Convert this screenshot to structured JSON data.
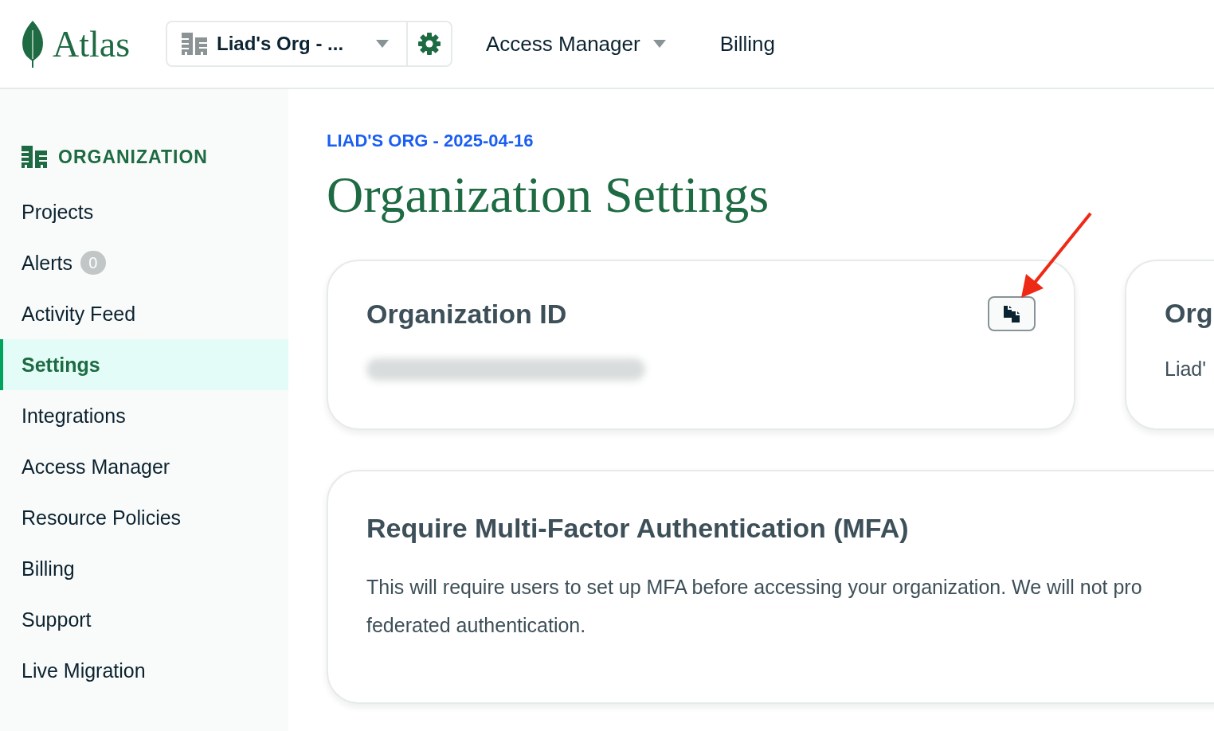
{
  "header": {
    "logo": "Atlas",
    "org_selector": {
      "value": "Liad's Org - ..."
    },
    "nav": [
      {
        "label": "Access Manager",
        "kind": "dropdown"
      },
      {
        "label": "Billing",
        "kind": "link"
      }
    ]
  },
  "sidebar": {
    "heading": "ORGANIZATION",
    "items": [
      {
        "label": "Projects",
        "selected": false
      },
      {
        "label": "Alerts",
        "selected": false,
        "badge": "0"
      },
      {
        "label": "Activity Feed",
        "selected": false
      },
      {
        "label": "Settings",
        "selected": true
      },
      {
        "label": "Integrations",
        "selected": false
      },
      {
        "label": "Access Manager",
        "selected": false
      },
      {
        "label": "Resource Policies",
        "selected": false
      },
      {
        "label": "Billing",
        "selected": false
      },
      {
        "label": "Support",
        "selected": false
      },
      {
        "label": "Live Migration",
        "selected": false
      }
    ]
  },
  "main": {
    "breadcrumb": "LIAD'S ORG - 2025-04-16",
    "title": "Organization Settings",
    "cards": [
      {
        "title": "Organization ID",
        "value_redacted": true
      },
      {
        "title": "Org",
        "value": "Liad'"
      }
    ],
    "mfa": {
      "title": "Require Multi-Factor Authentication (MFA)",
      "text": "This will require users to set up MFA before accessing your organization. We will not pro\nfederated authentication."
    }
  }
}
